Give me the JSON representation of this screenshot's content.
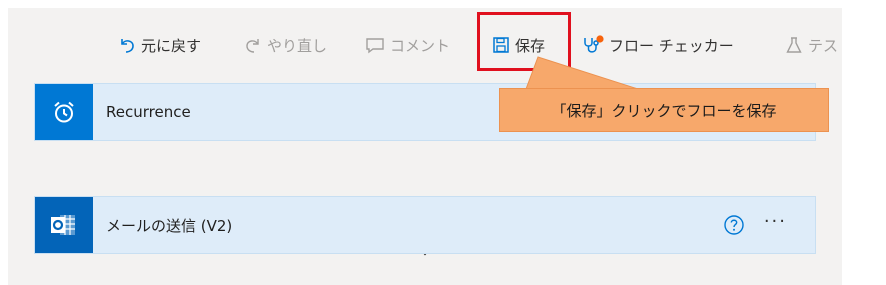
{
  "toolbar": {
    "undo_label": "元に戻す",
    "redo_label": "やり直し",
    "comment_label": "コメント",
    "save_label": "保存",
    "checker_label": "フロー チェッカー",
    "test_label": "テス"
  },
  "flow": {
    "recurrence_title": "Recurrence",
    "mail_title": "メールの送信 (V2)",
    "more_label": "···"
  },
  "callout": {
    "text": "「保存」クリックでフローを保存"
  },
  "colors": {
    "accent": "#0078d4",
    "card_bg": "#deecf9",
    "callout_bg": "#f7a86b",
    "highlight_border": "#e0101e",
    "checker_badge": "#f7630c"
  }
}
